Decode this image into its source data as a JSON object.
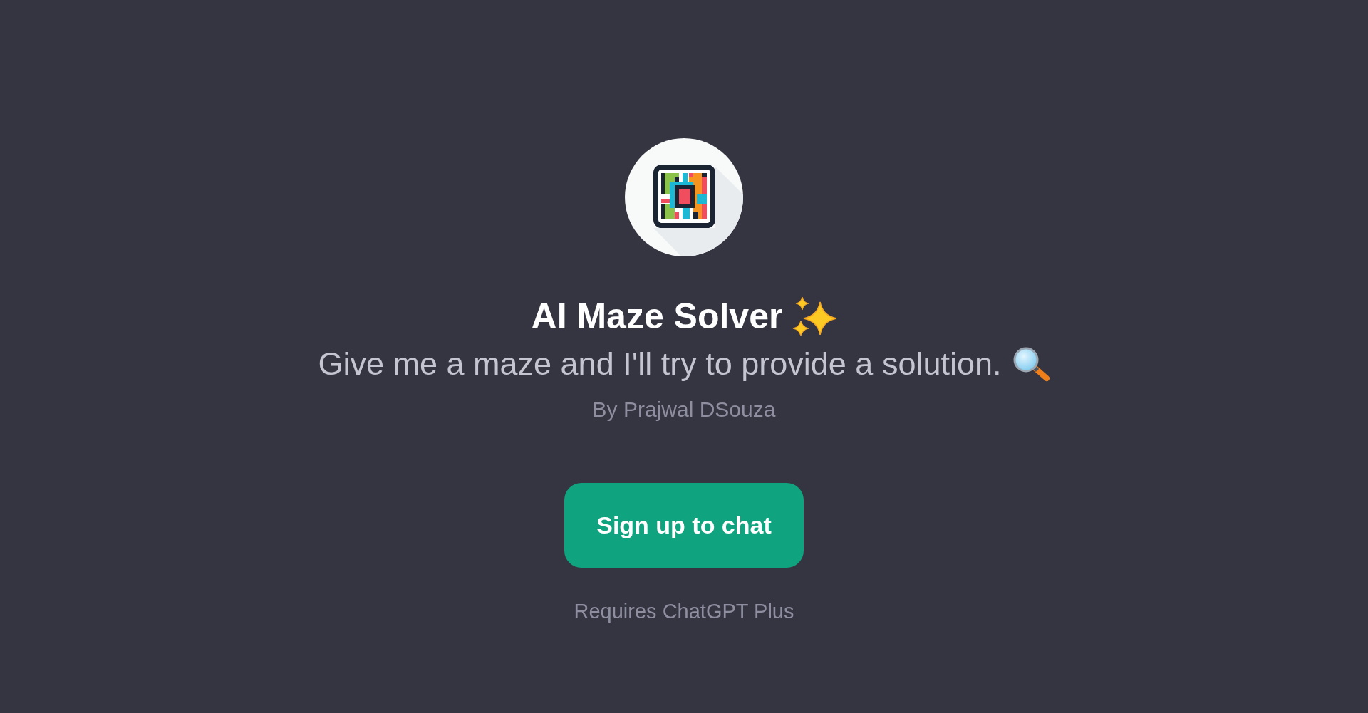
{
  "gpt": {
    "title": "AI Maze Solver",
    "description": "Give me a maze and I'll try to provide a solution.",
    "author": "By Prajwal DSouza"
  },
  "signup_button": {
    "label": "Sign up to chat"
  },
  "requirement_note": "Requires ChatGPT Plus"
}
